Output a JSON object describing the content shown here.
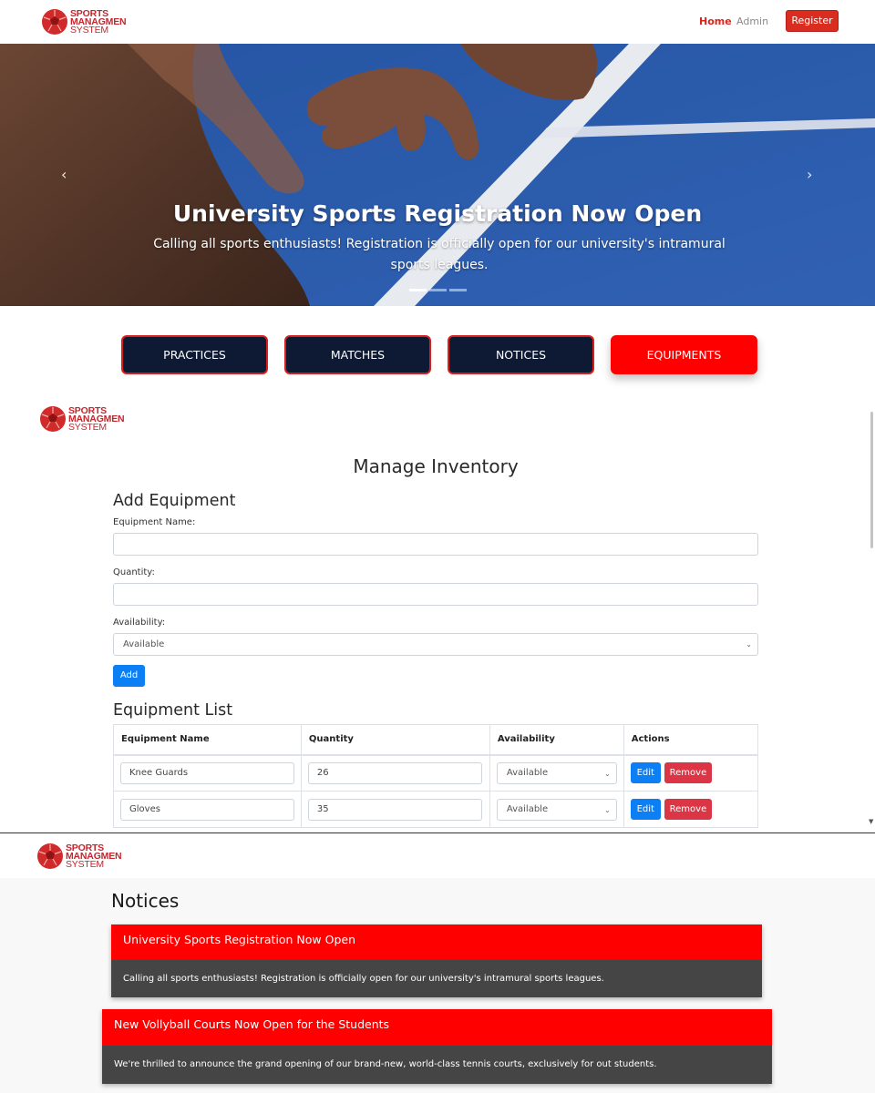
{
  "brand": {
    "line1": "SPORTS",
    "line2": "MANAGMEN",
    "line3": "SYSTEM"
  },
  "nav": {
    "home": "Home",
    "admin": "Admin",
    "register": "Register"
  },
  "hero": {
    "title": "University Sports Registration Now Open",
    "text": "Calling all sports enthusiasts! Registration is officially open for our university's intramural sports leagues.",
    "prev": "‹",
    "next": "›"
  },
  "categories": [
    "PRACTICES",
    "MATCHES",
    "NOTICES",
    "EQUIPMENTS"
  ],
  "inventory": {
    "title": "Manage Inventory",
    "add_heading": "Add Equipment",
    "name_label": "Equipment Name:",
    "quantity_label": "Quantity:",
    "availability_label": "Availability:",
    "availability_value": "Available",
    "add_button": "Add",
    "list_heading": "Equipment List",
    "columns": [
      "Equipment Name",
      "Quantity",
      "Availability",
      "Actions"
    ],
    "rows": [
      {
        "name": "Knee Guards",
        "quantity": "26",
        "availability": "Available"
      },
      {
        "name": "Gloves",
        "quantity": "35",
        "availability": "Available"
      }
    ],
    "edit_label": "Edit",
    "remove_label": "Remove"
  },
  "notices": {
    "title": "Notices",
    "items": [
      {
        "heading": "University Sports Registration Now Open",
        "body": "Calling all sports enthusiasts! Registration is officially open for our university's intramural sports leagues."
      },
      {
        "heading": "New Vollyball Courts Now Open for the Students",
        "body": "We're thrilled to announce the grand opening of our brand-new, world-class tennis courts, exclusively for out students."
      }
    ]
  },
  "colors": {
    "accent": "#fe0000",
    "navy": "#0e1a33",
    "primary": "#0d7ff5",
    "danger": "#dc3545",
    "notice_body": "#454545"
  }
}
